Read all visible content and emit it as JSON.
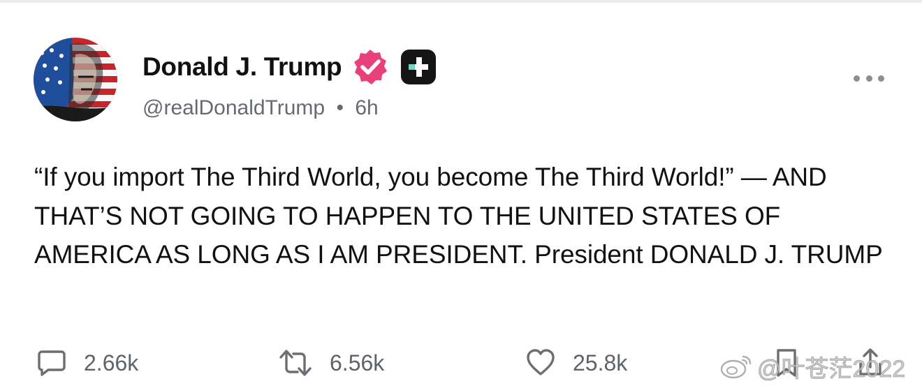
{
  "post": {
    "author": {
      "display_name": "Donald J. Trump",
      "handle": "@realDonaldTrump",
      "separator": "•",
      "time_ago": "6h",
      "verified": true,
      "avatar_icon": "flag-portrait-avatar"
    },
    "body": "“If you import The Third World, you become The Third World!” — AND THAT’S NOT GOING TO HAPPEN TO THE UNITED STATES OF AMERICA AS LONG AS I AM PRESIDENT. President DONALD J. TRUMP",
    "actions": {
      "replies": {
        "icon": "comment-icon",
        "count": "2.66k"
      },
      "retruths": {
        "icon": "repost-icon",
        "count": "6.56k"
      },
      "likes": {
        "icon": "heart-icon",
        "count": "25.8k"
      },
      "bookmark": {
        "icon": "bookmark-icon"
      },
      "share": {
        "icon": "share-icon"
      }
    }
  },
  "watermark": {
    "text": "@叶苍茫2022",
    "icon": "weibo-icon"
  },
  "colors": {
    "verified_badge": "#e8407a",
    "plus_badge": "#141414",
    "plus_badge_accent": "#5be0c6",
    "muted_text": "#666a70"
  }
}
